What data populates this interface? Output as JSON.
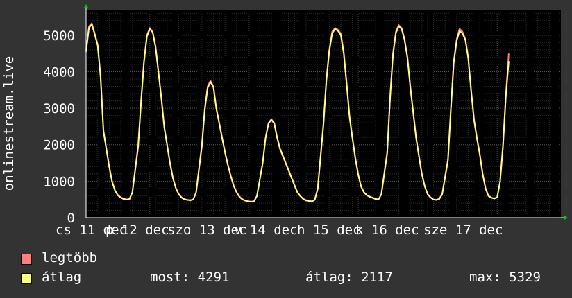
{
  "chart_data": {
    "type": "line",
    "ylabel": "onlinestream.live",
    "ylim": [
      0,
      5700
    ],
    "yticks": [
      0,
      1000,
      2000,
      3000,
      4000,
      5000
    ],
    "xtick_labels": [
      "cs 11 dec",
      "p 12 dec",
      "szo 13 dec",
      "v 14 dec",
      "h 15 dec",
      "k 16 dec",
      "sze 17 dec"
    ],
    "x_range_hours": [
      0,
      164
    ],
    "series": [
      {
        "name": "legtöbb",
        "color": "#ff7f7f",
        "points": [
          [
            0,
            4600
          ],
          [
            1,
            5250
          ],
          [
            2,
            5330
          ],
          [
            3,
            5050
          ],
          [
            4,
            4750
          ],
          [
            5,
            3900
          ],
          [
            6,
            2400
          ],
          [
            7,
            1900
          ],
          [
            8,
            1400
          ],
          [
            9,
            1000
          ],
          [
            10,
            750
          ],
          [
            11,
            620
          ],
          [
            12,
            560
          ],
          [
            13,
            520
          ],
          [
            14,
            500
          ],
          [
            15,
            520
          ],
          [
            16,
            700
          ],
          [
            18,
            2000
          ],
          [
            19,
            3200
          ],
          [
            20,
            4300
          ],
          [
            21,
            5000
          ],
          [
            22,
            5200
          ],
          [
            23,
            5100
          ],
          [
            24,
            4700
          ],
          [
            25,
            4000
          ],
          [
            26,
            3300
          ],
          [
            27,
            2500
          ],
          [
            28,
            2000
          ],
          [
            29,
            1500
          ],
          [
            30,
            1100
          ],
          [
            31,
            820
          ],
          [
            32,
            650
          ],
          [
            33,
            560
          ],
          [
            34,
            510
          ],
          [
            35,
            490
          ],
          [
            36,
            480
          ],
          [
            37,
            500
          ],
          [
            38,
            700
          ],
          [
            40,
            2000
          ],
          [
            41,
            3000
          ],
          [
            42,
            3600
          ],
          [
            43,
            3750
          ],
          [
            44,
            3600
          ],
          [
            45,
            3000
          ],
          [
            46,
            2600
          ],
          [
            47,
            2200
          ],
          [
            48,
            1800
          ],
          [
            49,
            1450
          ],
          [
            50,
            1150
          ],
          [
            51,
            880
          ],
          [
            52,
            700
          ],
          [
            53,
            580
          ],
          [
            54,
            510
          ],
          [
            55,
            470
          ],
          [
            56,
            450
          ],
          [
            57,
            440
          ],
          [
            58,
            450
          ],
          [
            59,
            600
          ],
          [
            61,
            1500
          ],
          [
            62,
            2200
          ],
          [
            63,
            2600
          ],
          [
            64,
            2700
          ],
          [
            65,
            2600
          ],
          [
            66,
            2200
          ],
          [
            67,
            1900
          ],
          [
            68,
            1700
          ],
          [
            69,
            1500
          ],
          [
            70,
            1300
          ],
          [
            71,
            1100
          ],
          [
            72,
            900
          ],
          [
            73,
            700
          ],
          [
            74,
            600
          ],
          [
            75,
            520
          ],
          [
            76,
            480
          ],
          [
            77,
            460
          ],
          [
            78,
            450
          ],
          [
            79,
            500
          ],
          [
            80,
            800
          ],
          [
            82,
            2600
          ],
          [
            83,
            3800
          ],
          [
            84,
            4600
          ],
          [
            85,
            5100
          ],
          [
            86,
            5200
          ],
          [
            87,
            5150
          ],
          [
            88,
            5050
          ],
          [
            89,
            4550
          ],
          [
            90,
            3700
          ],
          [
            91,
            2800
          ],
          [
            92,
            2200
          ],
          [
            93,
            1650
          ],
          [
            94,
            1200
          ],
          [
            95,
            860
          ],
          [
            96,
            700
          ],
          [
            97,
            620
          ],
          [
            98,
            580
          ],
          [
            99,
            550
          ],
          [
            100,
            520
          ],
          [
            101,
            500
          ],
          [
            102,
            650
          ],
          [
            104,
            1800
          ],
          [
            105,
            3300
          ],
          [
            106,
            4500
          ],
          [
            107,
            5100
          ],
          [
            108,
            5280
          ],
          [
            109,
            5200
          ],
          [
            110,
            4900
          ],
          [
            111,
            4400
          ],
          [
            112,
            3600
          ],
          [
            113,
            2900
          ],
          [
            114,
            2200
          ],
          [
            115,
            1700
          ],
          [
            116,
            1200
          ],
          [
            117,
            860
          ],
          [
            118,
            650
          ],
          [
            119,
            560
          ],
          [
            120,
            500
          ],
          [
            121,
            490
          ],
          [
            122,
            520
          ],
          [
            123,
            650
          ],
          [
            125,
            1600
          ],
          [
            126,
            3000
          ],
          [
            127,
            4300
          ],
          [
            128,
            4900
          ],
          [
            129,
            5180
          ],
          [
            130,
            5100
          ],
          [
            131,
            4900
          ],
          [
            132,
            4400
          ],
          [
            133,
            3500
          ],
          [
            134,
            2700
          ],
          [
            135,
            2200
          ],
          [
            136,
            1750
          ],
          [
            137,
            1200
          ],
          [
            138,
            800
          ],
          [
            139,
            600
          ],
          [
            140,
            550
          ],
          [
            141,
            530
          ],
          [
            142,
            560
          ],
          [
            143,
            1000
          ],
          [
            144,
            2000
          ],
          [
            145,
            3400
          ],
          [
            146,
            4500
          ]
        ]
      },
      {
        "name": "átlag",
        "color": "#ffff7f",
        "points": [
          [
            0,
            4550
          ],
          [
            1,
            5200
          ],
          [
            2,
            5300
          ],
          [
            3,
            5020
          ],
          [
            4,
            4720
          ],
          [
            5,
            3850
          ],
          [
            6,
            2380
          ],
          [
            7,
            1880
          ],
          [
            8,
            1380
          ],
          [
            9,
            980
          ],
          [
            10,
            740
          ],
          [
            11,
            610
          ],
          [
            12,
            550
          ],
          [
            13,
            510
          ],
          [
            14,
            495
          ],
          [
            15,
            510
          ],
          [
            16,
            690
          ],
          [
            18,
            1950
          ],
          [
            19,
            3150
          ],
          [
            20,
            4250
          ],
          [
            21,
            4960
          ],
          [
            22,
            5170
          ],
          [
            23,
            5080
          ],
          [
            24,
            4680
          ],
          [
            25,
            3980
          ],
          [
            26,
            3280
          ],
          [
            27,
            2480
          ],
          [
            28,
            1980
          ],
          [
            29,
            1480
          ],
          [
            30,
            1080
          ],
          [
            31,
            810
          ],
          [
            32,
            640
          ],
          [
            33,
            550
          ],
          [
            34,
            500
          ],
          [
            35,
            485
          ],
          [
            36,
            475
          ],
          [
            37,
            495
          ],
          [
            38,
            680
          ],
          [
            40,
            1950
          ],
          [
            41,
            2950
          ],
          [
            42,
            3560
          ],
          [
            43,
            3720
          ],
          [
            44,
            3570
          ],
          [
            45,
            2980
          ],
          [
            46,
            2580
          ],
          [
            47,
            2180
          ],
          [
            48,
            1780
          ],
          [
            49,
            1430
          ],
          [
            50,
            1130
          ],
          [
            51,
            870
          ],
          [
            52,
            690
          ],
          [
            53,
            570
          ],
          [
            54,
            500
          ],
          [
            55,
            465
          ],
          [
            56,
            445
          ],
          [
            57,
            435
          ],
          [
            58,
            445
          ],
          [
            59,
            590
          ],
          [
            61,
            1480
          ],
          [
            62,
            2180
          ],
          [
            63,
            2580
          ],
          [
            64,
            2680
          ],
          [
            65,
            2580
          ],
          [
            66,
            2180
          ],
          [
            67,
            1880
          ],
          [
            68,
            1680
          ],
          [
            69,
            1480
          ],
          [
            70,
            1280
          ],
          [
            71,
            1080
          ],
          [
            72,
            880
          ],
          [
            73,
            690
          ],
          [
            74,
            590
          ],
          [
            75,
            510
          ],
          [
            76,
            470
          ],
          [
            77,
            455
          ],
          [
            78,
            445
          ],
          [
            79,
            490
          ],
          [
            80,
            780
          ],
          [
            82,
            2550
          ],
          [
            83,
            3750
          ],
          [
            84,
            4550
          ],
          [
            85,
            5050
          ],
          [
            86,
            5170
          ],
          [
            87,
            5120
          ],
          [
            88,
            5000
          ],
          [
            89,
            4500
          ],
          [
            90,
            3650
          ],
          [
            91,
            2760
          ],
          [
            92,
            2170
          ],
          [
            93,
            1620
          ],
          [
            94,
            1180
          ],
          [
            95,
            850
          ],
          [
            96,
            690
          ],
          [
            97,
            610
          ],
          [
            98,
            570
          ],
          [
            99,
            540
          ],
          [
            100,
            510
          ],
          [
            101,
            495
          ],
          [
            102,
            640
          ],
          [
            104,
            1760
          ],
          [
            105,
            3250
          ],
          [
            106,
            4460
          ],
          [
            107,
            5060
          ],
          [
            108,
            5250
          ],
          [
            109,
            5170
          ],
          [
            110,
            4870
          ],
          [
            111,
            4370
          ],
          [
            112,
            3570
          ],
          [
            113,
            2870
          ],
          [
            114,
            2170
          ],
          [
            115,
            1670
          ],
          [
            116,
            1180
          ],
          [
            117,
            850
          ],
          [
            118,
            640
          ],
          [
            119,
            550
          ],
          [
            120,
            495
          ],
          [
            121,
            485
          ],
          [
            122,
            510
          ],
          [
            123,
            640
          ],
          [
            125,
            1560
          ],
          [
            126,
            2950
          ],
          [
            127,
            4250
          ],
          [
            128,
            4850
          ],
          [
            129,
            5120
          ],
          [
            130,
            5050
          ],
          [
            131,
            4870
          ],
          [
            132,
            4370
          ],
          [
            133,
            3470
          ],
          [
            134,
            2670
          ],
          [
            135,
            2170
          ],
          [
            136,
            1720
          ],
          [
            137,
            1180
          ],
          [
            138,
            790
          ],
          [
            139,
            590
          ],
          [
            140,
            545
          ],
          [
            141,
            525
          ],
          [
            142,
            555
          ],
          [
            143,
            980
          ],
          [
            144,
            1950
          ],
          [
            145,
            3350
          ],
          [
            146,
            4291
          ]
        ]
      }
    ],
    "grid": true
  },
  "legend": {
    "items": [
      {
        "label": "legtöbb",
        "color": "#ff7f7f"
      },
      {
        "label": "átlag",
        "color": "#ffff7f"
      }
    ],
    "stats": {
      "most": "most: 4291",
      "atlag": "átlag: 2117",
      "max": "max: 5329"
    }
  }
}
